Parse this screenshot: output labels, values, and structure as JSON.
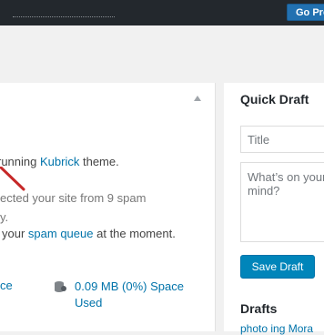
{
  "top_bar": {
    "go_button": "Go Pro"
  },
  "activity": {
    "theme_line_prefix": "running",
    "theme_name": "Kubrick",
    "theme_line_suffix": "theme.",
    "spam_line": "ected your site from 9 spam",
    "y_line": "y.",
    "queue_prefix": "your",
    "queue_link": "spam queue",
    "queue_suffix": "at the moment.",
    "space_link_left": "ce",
    "space_used": "0.09 MB (0%) Space Used"
  },
  "quick_draft": {
    "title": "Quick Draft",
    "title_placeholder": "Title",
    "content_placeholder": "What’s on your mind?",
    "save_button": "Save Draft",
    "drafts_heading": "Drafts",
    "draft_item": "photo ing Mora"
  }
}
